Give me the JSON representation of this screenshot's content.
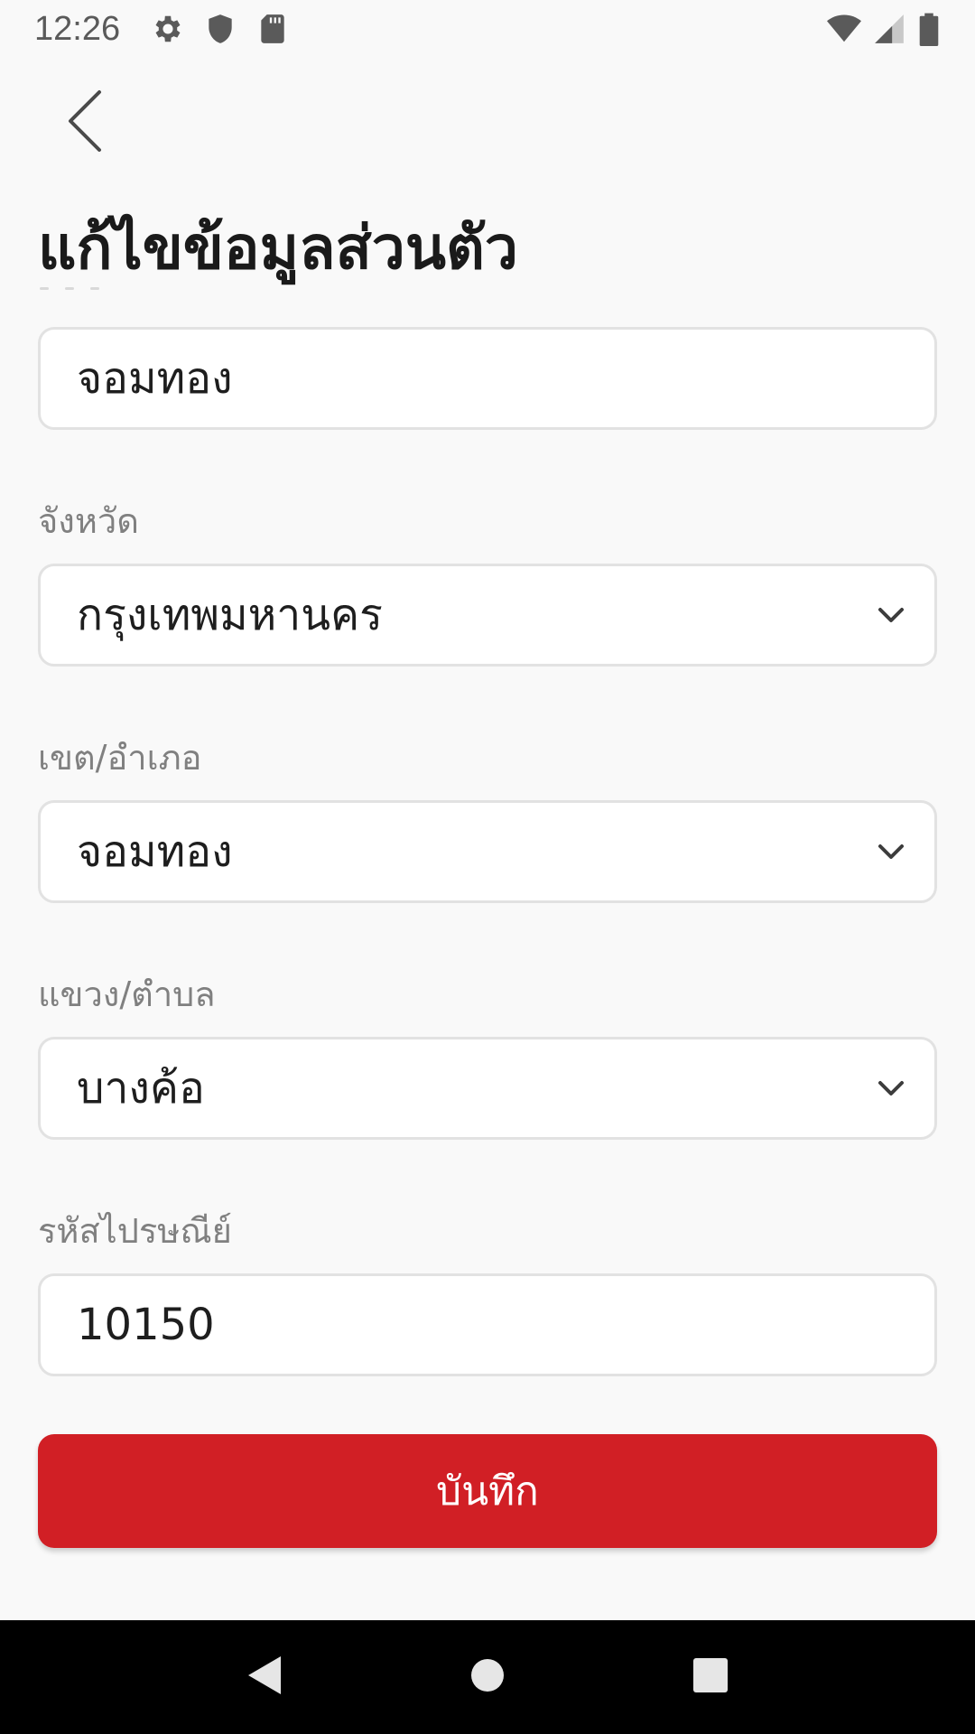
{
  "status_bar": {
    "time": "12:26",
    "left_icons": [
      "gear-icon",
      "shield-icon",
      "sd-card-icon"
    ],
    "right_icons": [
      "wifi-icon",
      "signal-icon",
      "battery-icon"
    ]
  },
  "header": {
    "back_icon": "chevron-left-icon",
    "title": "แก้ไขข้อมูลส่วนตัว"
  },
  "form": {
    "top_field": {
      "value": "จอมทอง"
    },
    "province": {
      "label": "จังหวัด",
      "value": "กรุงเทพมหานคร"
    },
    "district": {
      "label": "เขต/อำเภอ",
      "value": "จอมทอง"
    },
    "subdistrict": {
      "label": "แขวง/ตำบล",
      "value": "บางค้อ"
    },
    "postal_code": {
      "label": "รหัสไปรษณีย์",
      "value": "10150"
    }
  },
  "save_button": {
    "label": "บันทึก",
    "color": "#d11f25"
  },
  "nav_bar": {
    "icons": [
      "back-triangle-icon",
      "home-circle-icon",
      "recents-square-icon"
    ]
  }
}
